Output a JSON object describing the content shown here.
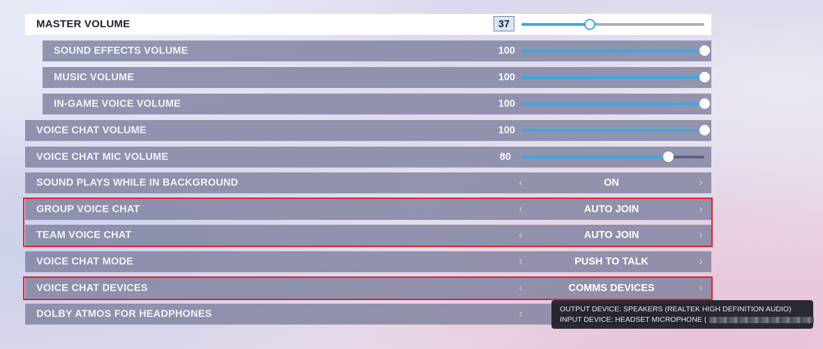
{
  "settings": {
    "master": {
      "label": "MASTER VOLUME",
      "value": "37",
      "level": 0.37
    },
    "sound_effects": {
      "label": "SOUND EFFECTS VOLUME",
      "value": "100",
      "level": 1.0
    },
    "music": {
      "label": "MUSIC VOLUME",
      "value": "100",
      "level": 1.0
    },
    "in_game_voice": {
      "label": "IN-GAME VOICE VOLUME",
      "value": "100",
      "level": 1.0
    },
    "voice_chat": {
      "label": "VOICE CHAT VOLUME",
      "value": "100",
      "level": 1.0
    },
    "voice_chat_mic": {
      "label": "VOICE CHAT MIC VOLUME",
      "value": "80",
      "level": 0.8
    },
    "sound_background": {
      "label": "SOUND PLAYS WHILE IN BACKGROUND",
      "value": "ON"
    },
    "group_voice_chat": {
      "label": "GROUP VOICE CHAT",
      "value": "AUTO JOIN"
    },
    "team_voice_chat": {
      "label": "TEAM VOICE CHAT",
      "value": "AUTO JOIN"
    },
    "voice_chat_mode": {
      "label": "VOICE CHAT MODE",
      "value": "PUSH TO TALK"
    },
    "voice_chat_devices": {
      "label": "VOICE CHAT DEVICES",
      "value": "COMMS DEVICES"
    },
    "dolby_atmos": {
      "label": "DOLBY ATMOS FOR HEADPHONES",
      "value": ""
    }
  },
  "tooltip": {
    "output": "OUTPUT DEVICE: SPEAKERS (REALTEK HIGH DEFINITION AUDIO)",
    "input": "INPUT DEVICE: HEADSET MICROPHONE ("
  },
  "icons": {
    "left": "chevron-left-icon",
    "right": "chevron-right-icon"
  },
  "colors": {
    "accent": "#3aa9e6",
    "highlight": "#d8252e",
    "row": "#7d809e"
  }
}
